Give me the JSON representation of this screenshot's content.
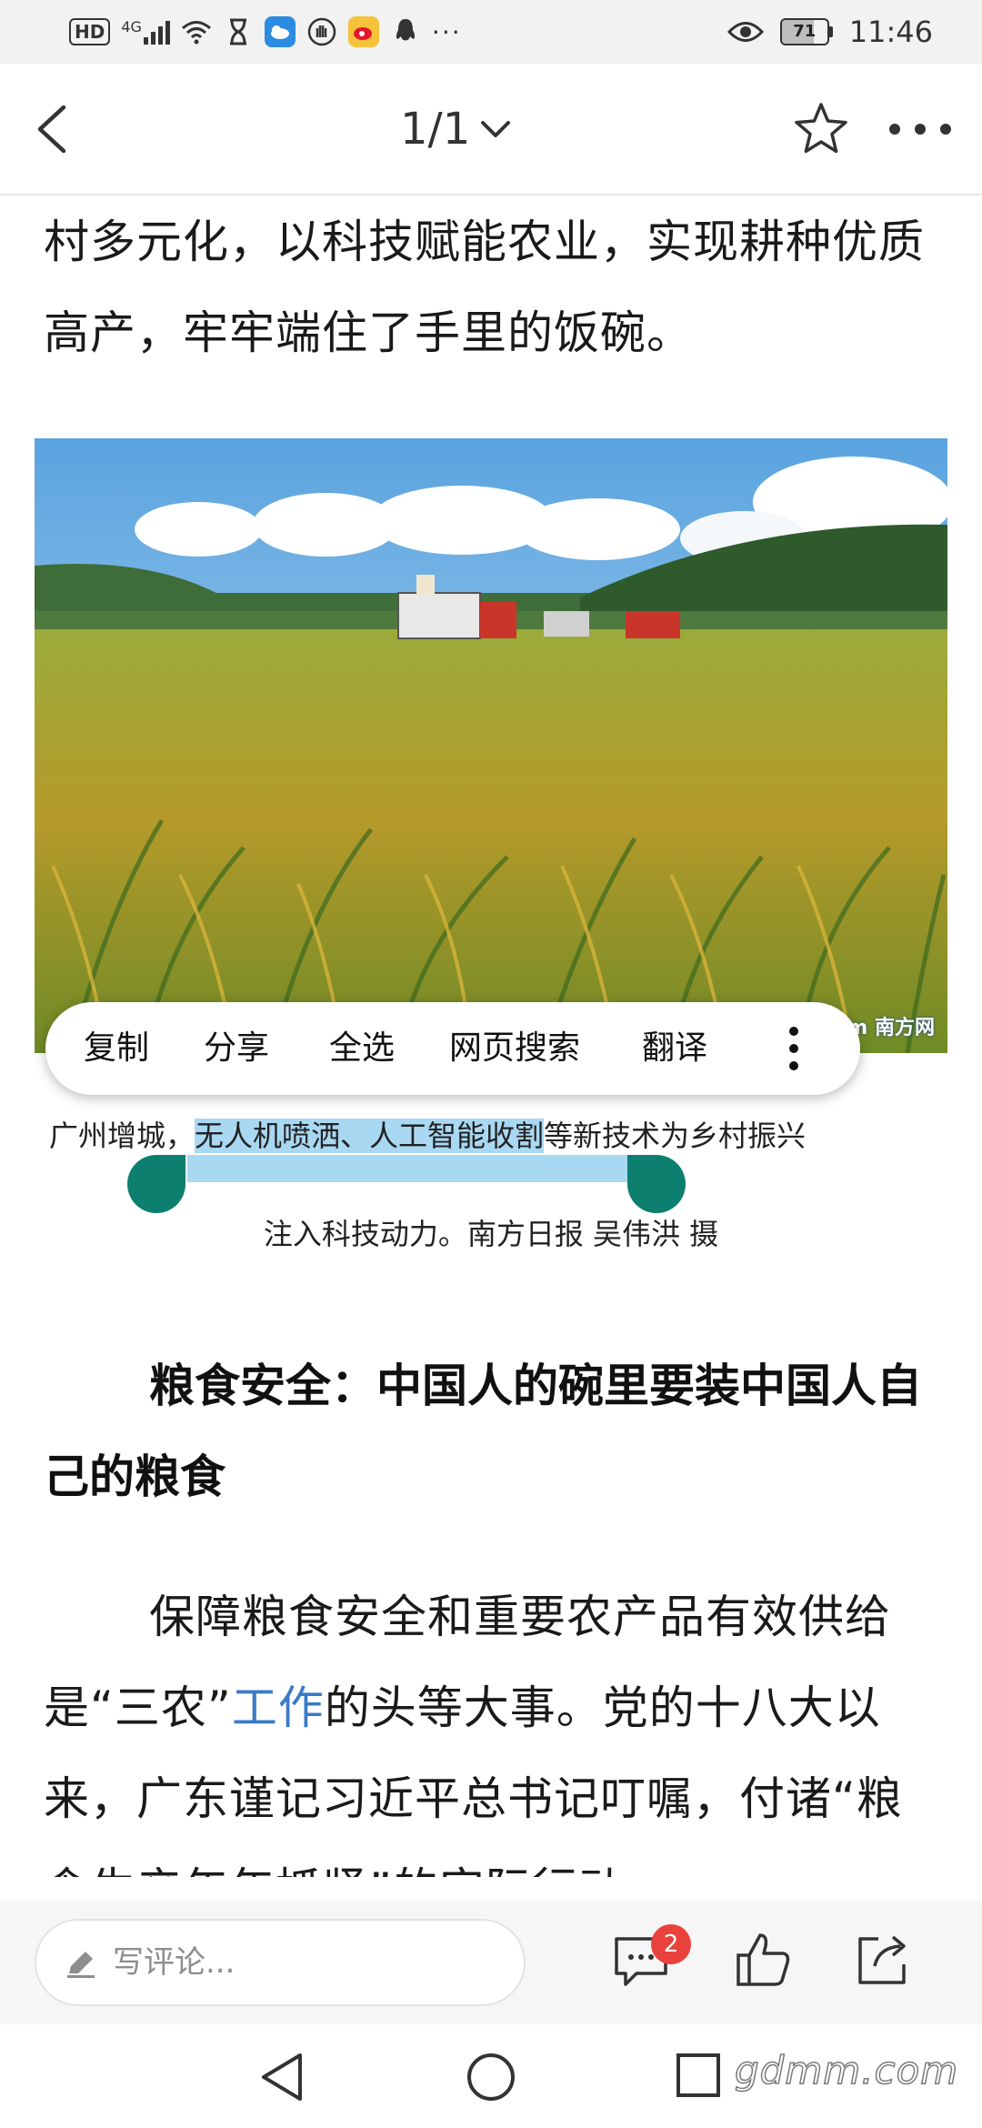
{
  "status_bar": {
    "hd_label": "HD",
    "signal_label": "4G",
    "battery": "71",
    "battery_level": 0.71,
    "time": "11:46",
    "more_dots": "···",
    "icons": [
      "hd-icon",
      "signal-icon",
      "wifi-icon",
      "hourglass-icon",
      "app-blue-icon",
      "hand-icon",
      "weibo-icon",
      "qq-icon",
      "eye-icon",
      "battery-icon"
    ]
  },
  "top_bar": {
    "page_indicator": "1/1",
    "icons": [
      "back-arrow-icon",
      "chevron-down-icon",
      "star-icon",
      "more-dots-icon"
    ]
  },
  "article": {
    "para_top": "村多元化，以科技赋能农业，实现耕种优质高产，牢牢端住了手里的饭碗。",
    "photo_watermark": "Southcn.com 南方网",
    "caption_line1_pre": "广州增城，",
    "caption_line1_selected": "无人机喷洒、人工智能收割",
    "caption_line1_post": "等新技术为乡村振兴",
    "caption_line2": "注入科技动力。南方日报 吴伟洪 摄",
    "heading": "粮食安全：中国人的碗里要装中国人自己的粮食",
    "para_body_pre": "保障粮食安全和重要农产品有效供给是“三农”",
    "para_body_link": "工作",
    "para_body_post": "的头等大事。党的十八大以来，广东谨记习近平总书记叮嘱，付诸“粮食生产年年抓紧”的实际行动"
  },
  "context_menu": {
    "items": [
      "复制",
      "分享",
      "全选",
      "网页搜索",
      "翻译"
    ]
  },
  "bottom_bar": {
    "comment_placeholder": "写评论...",
    "comment_count": "2",
    "icons": [
      "pencil-icon",
      "comment-icon",
      "like-icon",
      "share-icon"
    ]
  },
  "nav_bar": {
    "watermark": "gdmm.com",
    "icons": [
      "nav-back-icon",
      "nav-home-icon",
      "nav-recents-icon"
    ]
  },
  "colors": {
    "selection": "#a9d8f2",
    "handle": "#0c7f6e",
    "link": "#3b7bc6",
    "badge": "#e9423d"
  }
}
